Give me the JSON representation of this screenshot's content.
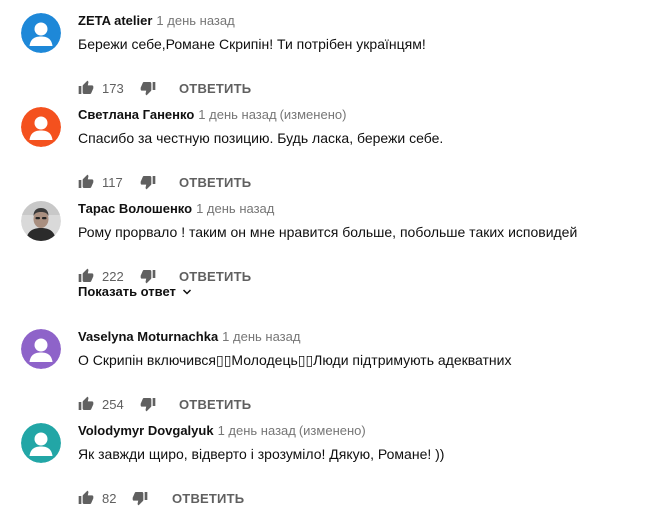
{
  "comments": [
    {
      "author": "ZETA atelier",
      "time": "1 день назад",
      "edited": "",
      "text": "Бережи себе,Романе Скрипін! Ти потрібен українцям!",
      "likes": "173",
      "reply_label": "ОТВЕТИТЬ",
      "avatar": "default-avatar-icon",
      "avatar_color": "#1e88d8"
    },
    {
      "author": "Светлана Ганенко",
      "time": "1 день назад",
      "edited": "(изменено)",
      "text": "Спасибо за честную позицию. Будь ласка, бережи себе.",
      "likes": "117",
      "reply_label": "ОТВЕТИТЬ",
      "avatar": "default-avatar-icon",
      "avatar_color": "#f4511e"
    },
    {
      "author": "Тарас Волошенко",
      "time": "1 день назад",
      "edited": "",
      "text": "Рому прорвало ! таким он мне нравится больше,  побольше таких исповидей",
      "likes": "222",
      "reply_label": "ОТВЕТИТЬ",
      "avatar": "profile-photo",
      "avatar_color": "#cfcfcf"
    },
    {
      "author": "Vaselyna Moturnachka",
      "time": "1 день назад",
      "edited": "",
      "text": "О Скрипін включився▯▯Молодець▯▯Люди підтримують адекватних",
      "likes": "254",
      "reply_label": "ОТВЕТИТЬ",
      "avatar": "default-avatar-icon",
      "avatar_color": "#8e63c9"
    },
    {
      "author": "Volodymyr Dovgalyuk",
      "time": "1 день назад",
      "edited": "(изменено)",
      "text": "Як завжди щиро, відверто і зрозуміло!  Дякую, Романе! ))",
      "likes": "82",
      "reply_label": "ОТВЕТИТЬ",
      "avatar": "default-avatar-icon",
      "avatar_color": "#22a6a6"
    }
  ],
  "show_replies": {
    "label": "Показать ответ",
    "icon": "chevron-down-icon"
  },
  "colors": {
    "text_primary": "#0f0f0f",
    "text_secondary": "#767676",
    "icon": "#606060"
  }
}
